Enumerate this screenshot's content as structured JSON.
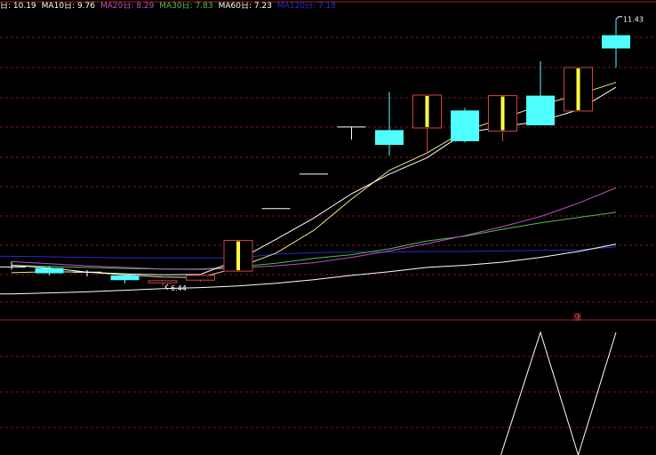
{
  "legend": {
    "ma5": {
      "label": "日: 10.19",
      "color": "#ffffff"
    },
    "ma10": {
      "label": "MA10日: 9.76",
      "color": "#ffffff"
    },
    "ma20": {
      "label": "MA20日: 8.29",
      "color": "#c050c0"
    },
    "ma30": {
      "label": "MA30日: 7.83",
      "color": "#50c050"
    },
    "ma60": {
      "label": "MA60日: 7.23",
      "color": "#ffffff"
    },
    "ma120": {
      "label": "MA120日: 7.18",
      "color": "#2a2ad0"
    }
  },
  "signal_label": "涨",
  "colors": {
    "background": "#000000",
    "grid": "#7a1414",
    "separator": "#9a2020",
    "up_candle": "#d04040",
    "down_candle": "#50ffff",
    "doji": "#ffffff",
    "inner_bar": "#ffff40",
    "ma5": "#ffffff",
    "ma10": "#e8e890",
    "ma20": "#c050c0",
    "ma30": "#50c050",
    "ma60": "#ffffff",
    "ma120": "#2a2ad0",
    "indicator": "#ffffff"
  },
  "chart_data": [
    {
      "type": "candlestick",
      "ylim": [
        5.8,
        11.8
      ],
      "max_label": "11.43",
      "min_label": "6.44",
      "candles": [
        {
          "open": 6.8,
          "close": 6.8,
          "high": 6.9,
          "low": 6.75
        },
        {
          "open": 6.78,
          "close": 6.68,
          "high": 6.82,
          "low": 6.64
        },
        {
          "open": 6.7,
          "close": 6.7,
          "high": 6.74,
          "low": 6.62
        },
        {
          "open": 6.64,
          "close": 6.55,
          "high": 6.68,
          "low": 6.49
        },
        {
          "open": 6.5,
          "close": 6.54,
          "high": 6.56,
          "low": 6.44
        },
        {
          "open": 6.55,
          "close": 6.64,
          "high": 6.66,
          "low": 6.52
        },
        {
          "open": 6.72,
          "close": 7.3,
          "high": 7.3,
          "low": 6.7
        },
        {
          "open": 7.9,
          "close": 7.9,
          "high": 7.9,
          "low": 7.9
        },
        {
          "open": 8.55,
          "close": 8.55,
          "high": 8.55,
          "low": 8.55
        },
        {
          "open": 9.44,
          "close": 9.44,
          "high": 9.44,
          "low": 9.2
        },
        {
          "open": 9.38,
          "close": 9.1,
          "high": 10.1,
          "low": 8.9
        },
        {
          "open": 9.42,
          "close": 10.04,
          "high": 10.04,
          "low": 8.93
        },
        {
          "open": 9.75,
          "close": 9.17,
          "high": 9.8,
          "low": 9.15
        },
        {
          "open": 9.36,
          "close": 10.03,
          "high": 10.03,
          "low": 9.17
        },
        {
          "open": 10.03,
          "close": 9.47,
          "high": 10.68,
          "low": 9.47
        },
        {
          "open": 9.74,
          "close": 10.56,
          "high": 10.56,
          "low": 9.74
        },
        {
          "open": 11.17,
          "close": 10.92,
          "high": 11.47,
          "low": 10.56
        }
      ],
      "ma_lines": {
        "ma5": [
          6.83,
          6.78,
          6.7,
          6.67,
          6.65,
          6.66,
          6.93,
          7.32,
          7.72,
          8.18,
          8.55,
          8.86,
          9.33,
          9.44,
          9.55,
          9.76,
          10.19
        ],
        "ma10": [
          6.69,
          6.71,
          6.7,
          6.65,
          6.61,
          6.6,
          6.79,
          7.06,
          7.49,
          8.08,
          8.62,
          8.95,
          9.37,
          9.6,
          9.85,
          10.05,
          10.28
        ],
        "ma20": [
          6.9,
          6.86,
          6.82,
          6.79,
          6.76,
          6.75,
          6.78,
          6.82,
          6.88,
          6.98,
          7.1,
          7.24,
          7.39,
          7.56,
          7.75,
          8.0,
          8.29
        ],
        "ma30": [
          6.83,
          6.81,
          6.79,
          6.77,
          6.76,
          6.76,
          6.8,
          6.87,
          6.96,
          7.03,
          7.14,
          7.29,
          7.38,
          7.51,
          7.63,
          7.73,
          7.83
        ],
        "ma60": [
          6.29,
          6.31,
          6.33,
          6.36,
          6.39,
          6.41,
          6.44,
          6.49,
          6.56,
          6.64,
          6.71,
          6.79,
          6.83,
          6.89,
          6.98,
          7.09,
          7.23
        ],
        "ma120": [
          7.0,
          6.99,
          6.98,
          6.97,
          6.97,
          6.97,
          6.97,
          7.04,
          7.07,
          7.08,
          7.08,
          7.09,
          7.09,
          7.1,
          7.11,
          7.12,
          7.18
        ]
      }
    },
    {
      "type": "line",
      "name": "",
      "ylim": [
        0,
        1
      ],
      "values": [
        null,
        null,
        null,
        null,
        null,
        null,
        null,
        null,
        null,
        null,
        null,
        null,
        null,
        null,
        1,
        0,
        1
      ],
      "from_values": [
        null,
        null,
        null,
        null,
        null,
        null,
        null,
        null,
        null,
        null,
        null,
        null,
        null,
        0,
        null,
        null,
        null
      ]
    }
  ]
}
